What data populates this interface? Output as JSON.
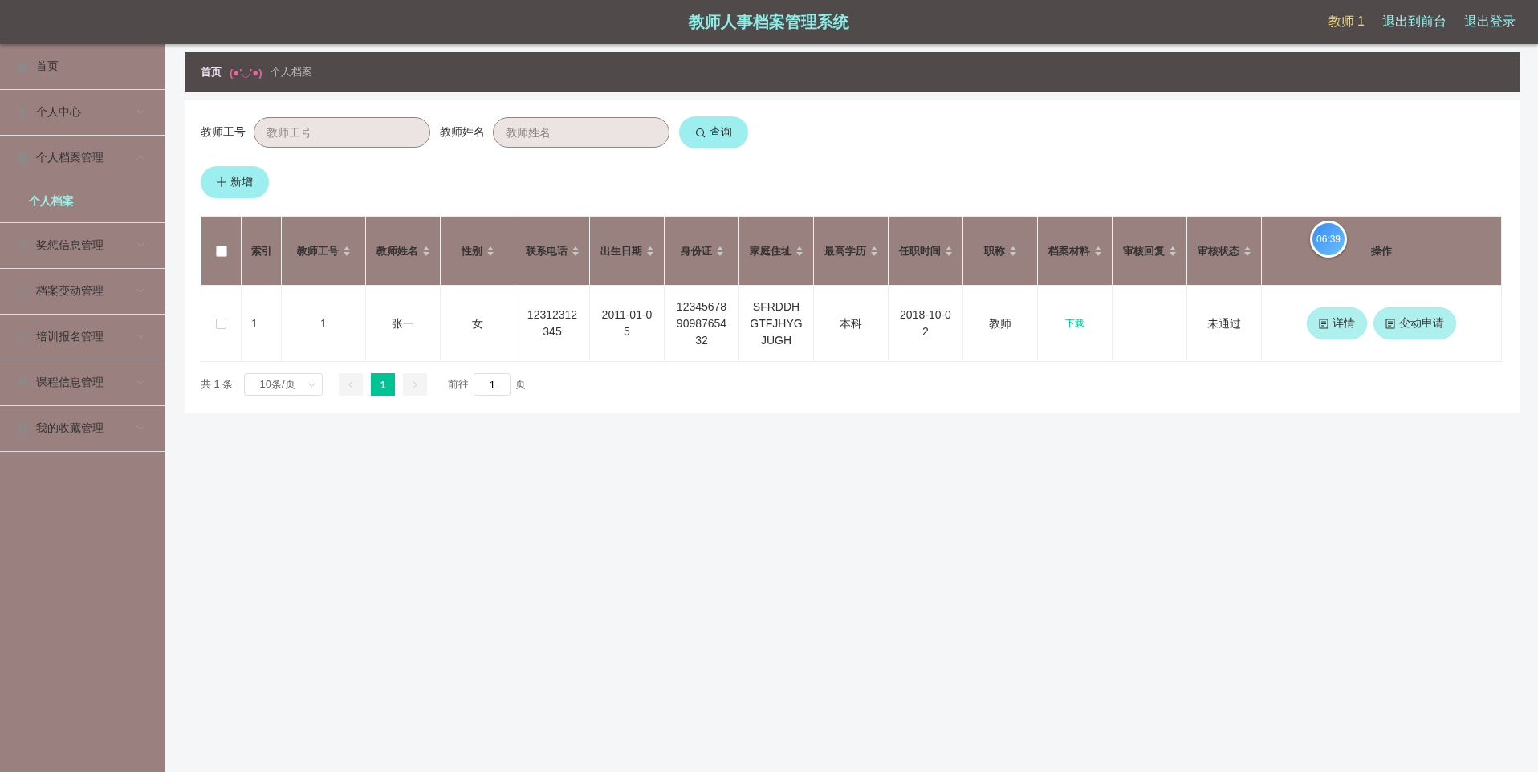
{
  "header": {
    "title": "教师人事档案管理系统",
    "user": "教师 1",
    "links": [
      "退出到前台",
      "退出登录"
    ]
  },
  "sidebar": {
    "items": [
      {
        "label": "首页",
        "expandable": false,
        "expanded": false
      },
      {
        "label": "个人中心",
        "expandable": true,
        "expanded": false
      },
      {
        "label": "个人档案管理",
        "expandable": true,
        "expanded": true,
        "children": [
          {
            "label": "个人档案",
            "selected": true
          }
        ]
      },
      {
        "label": "奖惩信息管理",
        "expandable": true,
        "expanded": false
      },
      {
        "label": "档案变动管理",
        "expandable": true,
        "expanded": false
      },
      {
        "label": "培训报名管理",
        "expandable": true,
        "expanded": false
      },
      {
        "label": "课程信息管理",
        "expandable": true,
        "expanded": false
      },
      {
        "label": "我的收藏管理",
        "expandable": true,
        "expanded": false
      }
    ]
  },
  "breadcrumb": {
    "home": "首页",
    "emoticon": "(●'◡'●)",
    "current": "个人档案"
  },
  "search": {
    "fields": [
      {
        "label": "教师工号",
        "placeholder": "教师工号"
      },
      {
        "label": "教师姓名",
        "placeholder": "教师姓名"
      }
    ],
    "button": "查询"
  },
  "add_button": "新增",
  "table": {
    "select_all": {
      "checked": false
    },
    "columns": [
      {
        "label": "索引",
        "sortable": false
      },
      {
        "label": "教师工号",
        "sortable": true
      },
      {
        "label": "教师姓名",
        "sortable": true
      },
      {
        "label": "性别",
        "sortable": true
      },
      {
        "label": "联系电话",
        "sortable": true
      },
      {
        "label": "出生日期",
        "sortable": true
      },
      {
        "label": "身份证",
        "sortable": true
      },
      {
        "label": "家庭住址",
        "sortable": true
      },
      {
        "label": "最高学历",
        "sortable": true
      },
      {
        "label": "任职时间",
        "sortable": true
      },
      {
        "label": "职称",
        "sortable": true
      },
      {
        "label": "档案材料",
        "sortable": true
      },
      {
        "label": "审核回复",
        "sortable": true
      },
      {
        "label": "审核状态",
        "sortable": true
      },
      {
        "label": "操作",
        "sortable": false
      }
    ],
    "rows": [
      {
        "checked": false,
        "cells": [
          "1",
          "1",
          "张一",
          "女",
          "12312312345",
          "2011-01-05",
          "123456789098765432",
          "SFRDDHGTFJHYGJUGH",
          "本科",
          "2018-10-02",
          "教师"
        ],
        "material_link": "下载",
        "status": "未通过",
        "actions": [
          "详情",
          "变动申请"
        ]
      }
    ]
  },
  "timer": "06:39",
  "pagination": {
    "total": "共 1 条",
    "page_size": "10条/页",
    "pages": [
      {
        "label": "1",
        "selected": true
      }
    ],
    "goto_label": "前往",
    "goto_value": "1",
    "goto_suffix": "页"
  }
}
